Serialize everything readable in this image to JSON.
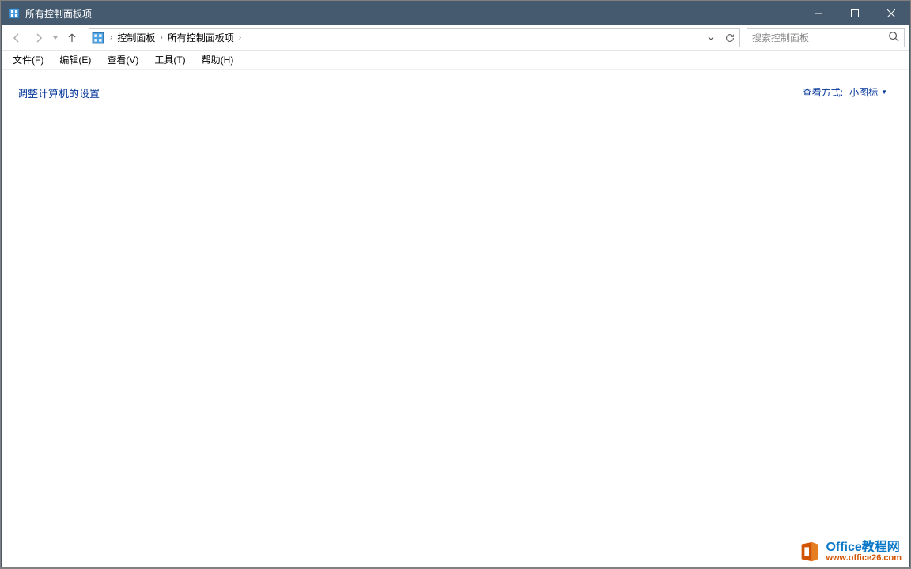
{
  "window": {
    "title": "所有控制面板项"
  },
  "breadcrumb": {
    "item1": "控制面板",
    "item2": "所有控制面板项"
  },
  "search": {
    "placeholder": "搜索控制面板"
  },
  "menu": {
    "file": "文件(F)",
    "edit": "编辑(E)",
    "view": "查看(V)",
    "tools": "工具(T)",
    "help": "帮助(H)"
  },
  "content": {
    "heading": "调整计算机的设置",
    "viewby_label": "查看方式:",
    "viewby_value": "小图标"
  },
  "watermark": {
    "line1a": "Office",
    "line1b": "教程网",
    "line2": "www.office26.com"
  }
}
